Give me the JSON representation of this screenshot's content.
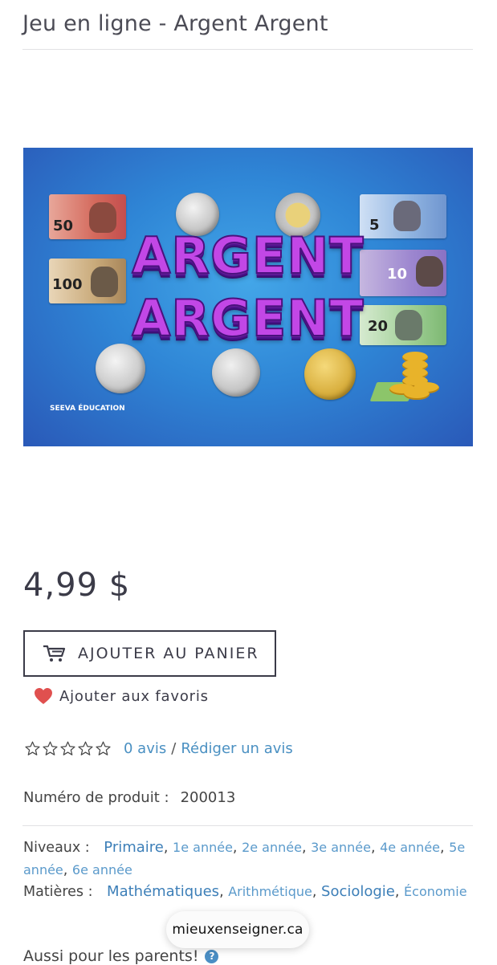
{
  "product": {
    "title": "Jeu en ligne - Argent Argent",
    "price": "4,99 $",
    "add_to_cart": "AJOUTER AU PANIER",
    "add_to_favorites": "Ajouter aux favoris",
    "rating": {
      "stars": 0,
      "max_stars": 5,
      "reviews_link": "0 avis",
      "separator": "/",
      "write_review_link": "Rédiger un avis"
    },
    "product_number_label": "Numéro de produit :",
    "product_number": "200013",
    "levels_label": "Niveaux :",
    "levels": [
      "Primaire",
      "1e année",
      "2e année",
      "3e année",
      "4e année",
      "5e année",
      "6e année"
    ],
    "subjects_label": "Matières :",
    "subjects": [
      "Mathématiques",
      "Arithmétique",
      "Sociologie",
      "Économie"
    ],
    "parents_text": "Aussi pour les parents!",
    "help_icon_glyph": "?"
  },
  "banner": {
    "line1": "ARGENT",
    "line2": "ARGENT",
    "credit": "SEEVA ÉDUCATION",
    "bills": [
      "50",
      "100",
      "5",
      "10",
      "20"
    ]
  },
  "site_pill": "mieuxenseigner.ca",
  "icons": {
    "cart": "cart-icon",
    "heart": "heart-icon",
    "star": "star-outline-icon",
    "help": "question-circle-icon"
  },
  "colors": {
    "link": "#4a90c2",
    "heart": "#e0504f",
    "text": "#3b3b48",
    "banner_bg": "#2f86d6",
    "banner_text": "#c247e6"
  }
}
